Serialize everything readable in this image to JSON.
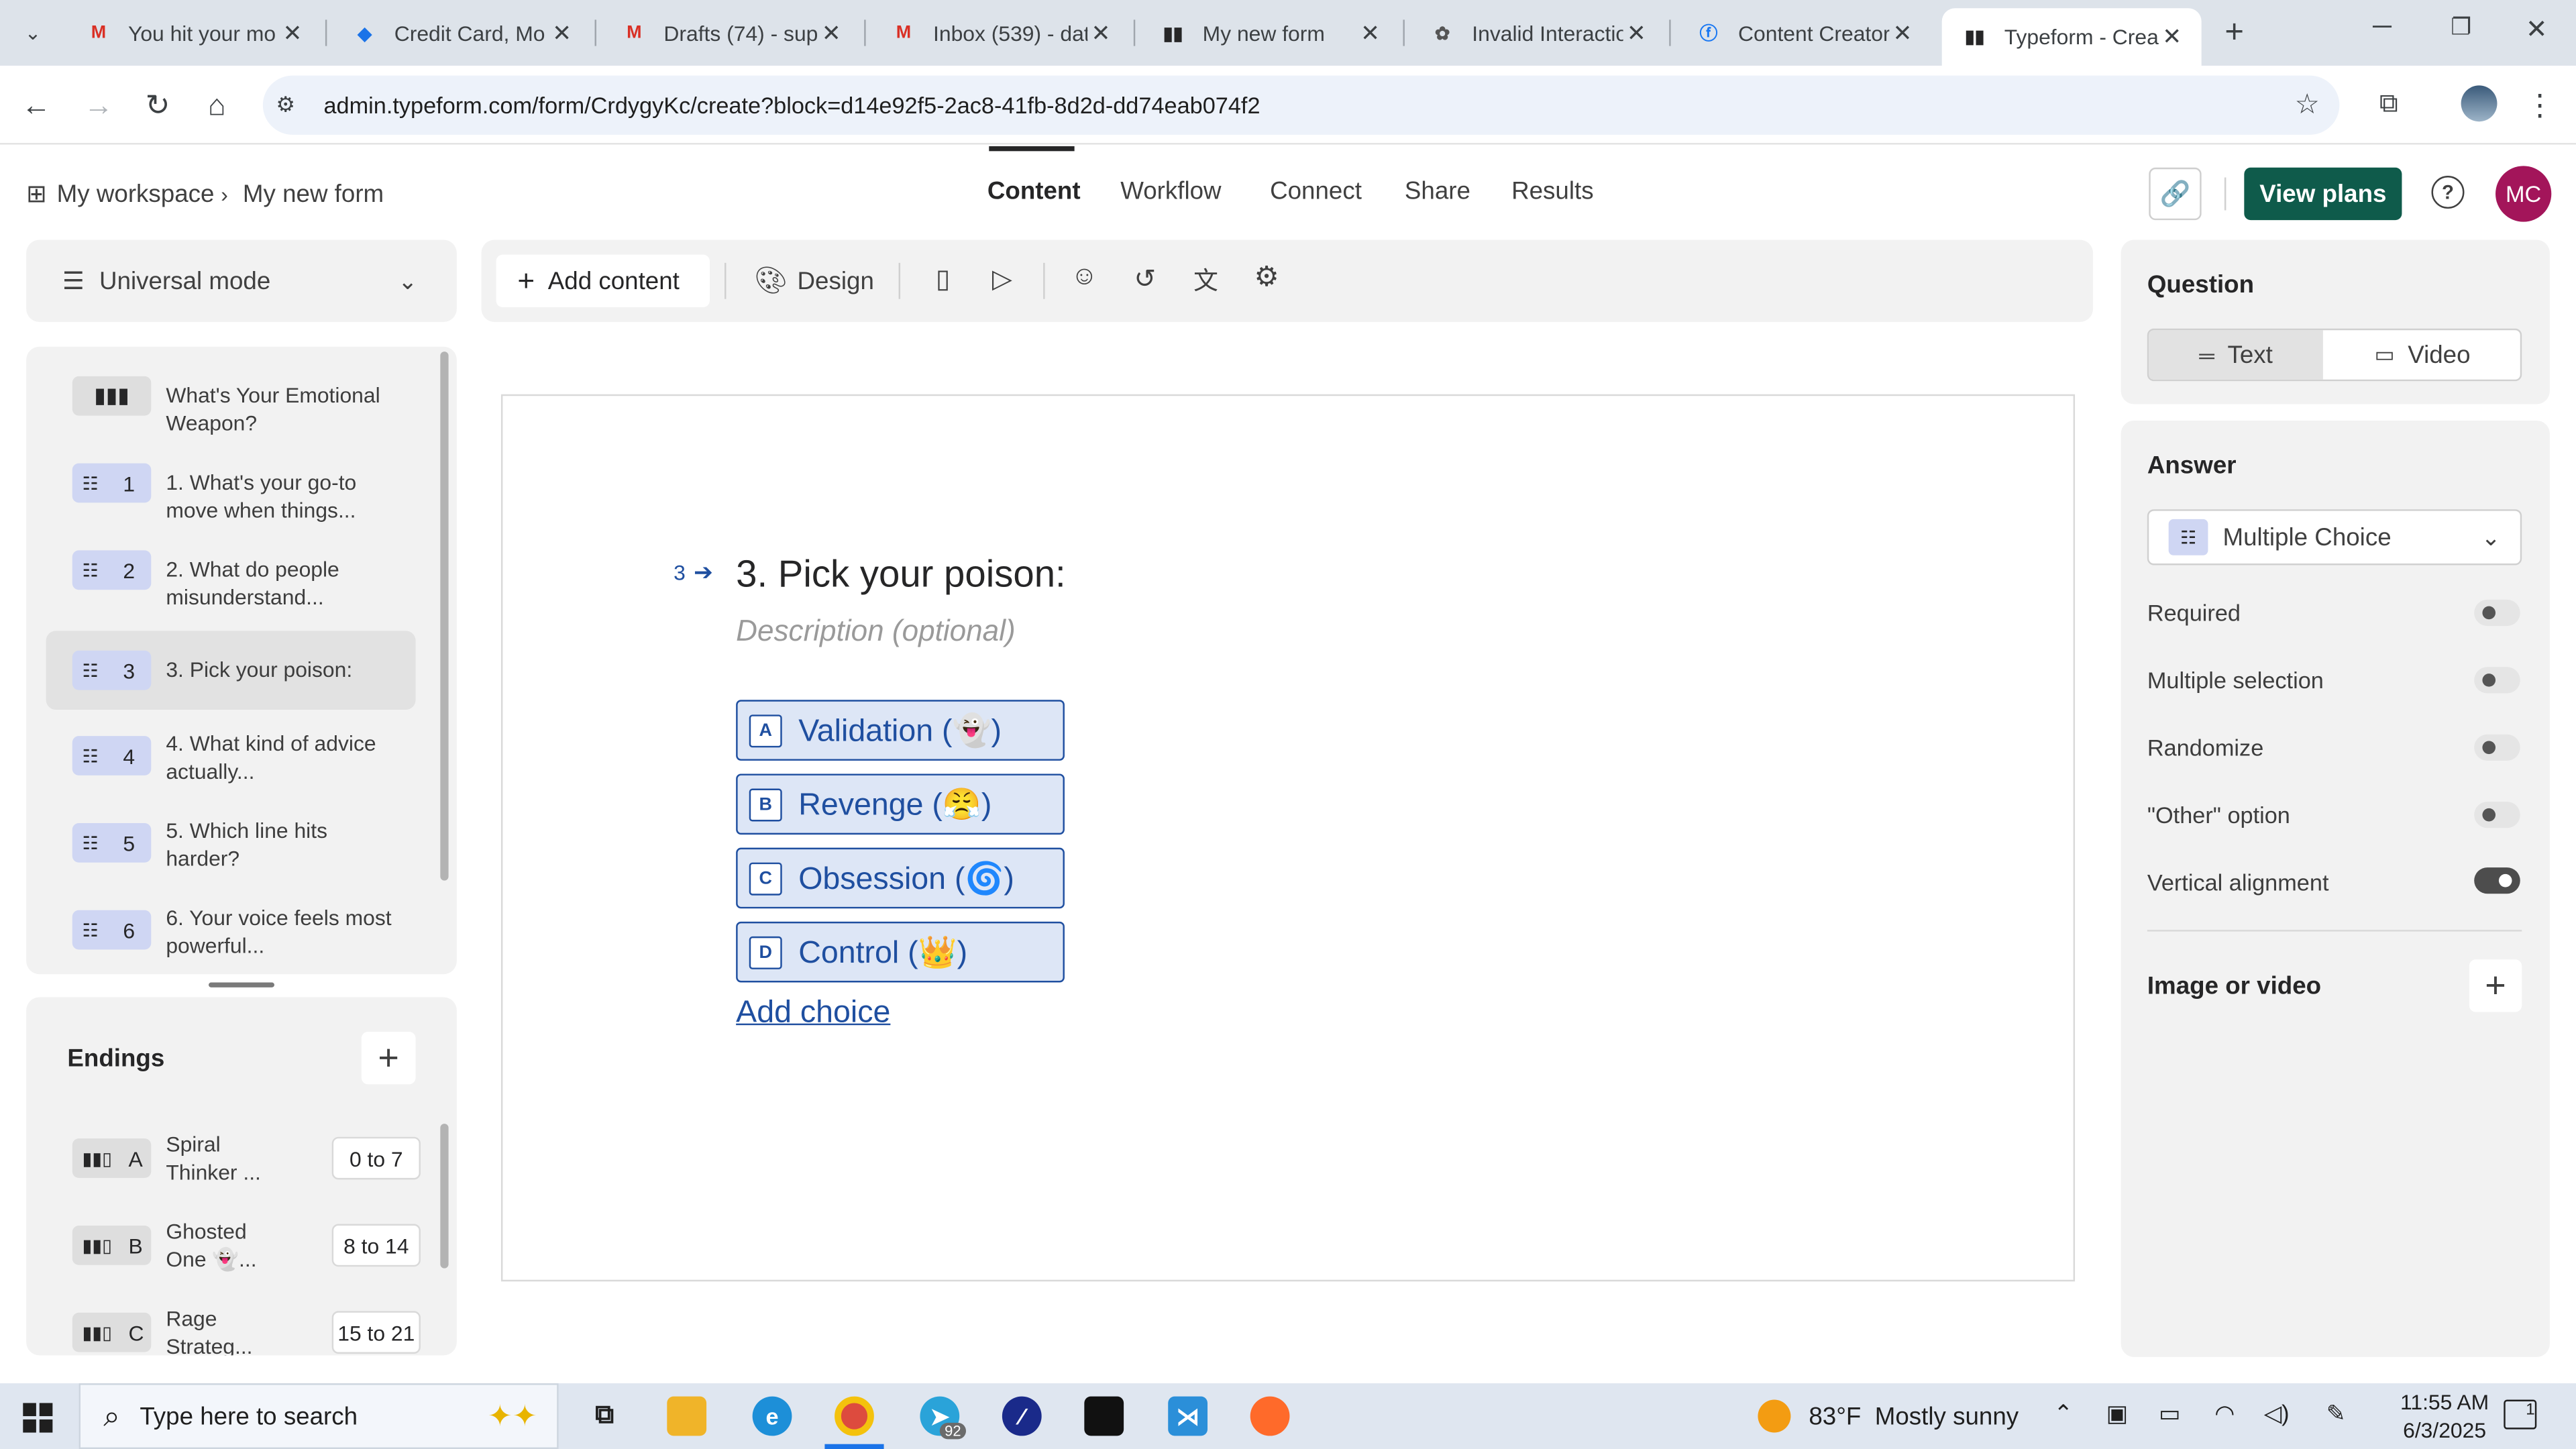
{
  "browser": {
    "tabs": [
      {
        "title": "You hit your mo",
        "favicon": "gmail-icon",
        "color": "#d93025"
      },
      {
        "title": "Credit Card, Mo",
        "favicon": "globe-icon",
        "color": "#1a73e8"
      },
      {
        "title": "Drafts (74) - sup",
        "favicon": "gmail-icon",
        "color": "#d93025"
      },
      {
        "title": "Inbox (539) - dat",
        "favicon": "gmail-icon",
        "color": "#d93025"
      },
      {
        "title": "My new form",
        "favicon": "typeform-icon",
        "color": "#262627"
      },
      {
        "title": "Invalid Interactio",
        "favicon": "openai-icon",
        "color": "#555555"
      },
      {
        "title": "Content Creator",
        "favicon": "facebook-icon",
        "color": "#1877f2"
      },
      {
        "title": "Typeform - Creat",
        "favicon": "typeform-icon",
        "color": "#262627"
      }
    ],
    "url": "admin.typeform.com/form/CrdygyKc/create?block=d14e92f5-2ac8-41fb-8d2d-dd74eab074f2"
  },
  "header": {
    "breadcrumb_workspace": "My workspace",
    "breadcrumb_form": "My new form",
    "nav": [
      "Content",
      "Workflow",
      "Connect",
      "Share",
      "Results"
    ],
    "view_plans": "View plans",
    "avatar_initials": "MC"
  },
  "left": {
    "mode_label": "Universal mode",
    "questions": [
      {
        "num": "",
        "text": "What's Your Emotional Weapon?"
      },
      {
        "num": "1",
        "text": "1. What's your go-to move when things..."
      },
      {
        "num": "2",
        "text": "2. What do people misunderstand..."
      },
      {
        "num": "3",
        "text": "3. Pick your poison:"
      },
      {
        "num": "4",
        "text": "4. What kind of advice actually..."
      },
      {
        "num": "5",
        "text": "5. Which line hits harder?"
      },
      {
        "num": "6",
        "text": "6. Your voice feels most powerful..."
      }
    ],
    "endings_title": "Endings",
    "endings": [
      {
        "letter": "A",
        "text": "Spiral Thinker ...",
        "range": "0 to 7"
      },
      {
        "letter": "B",
        "text": "Ghosted One 👻...",
        "range": "8 to 14"
      },
      {
        "letter": "C",
        "text": "Rage Strateg...",
        "range": "15 to 21"
      }
    ]
  },
  "toolbar": {
    "add_content": "Add content",
    "design": "Design"
  },
  "canvas": {
    "question_number": "3",
    "question_title": "3. Pick your poison:",
    "description_placeholder": "Description (optional)",
    "choices": [
      {
        "key": "A",
        "label": "Validation (👻)"
      },
      {
        "key": "B",
        "label": "Revenge (😤)"
      },
      {
        "key": "C",
        "label": "Obsession (🌀)"
      },
      {
        "key": "D",
        "label": "Control (👑)"
      }
    ],
    "add_choice": "Add choice"
  },
  "right": {
    "question_title": "Question",
    "text_tab": "Text",
    "video_tab": "Video",
    "answer_title": "Answer",
    "answer_type": "Multiple Choice",
    "settings": [
      {
        "label": "Required",
        "on": false
      },
      {
        "label": "Multiple selection",
        "on": false
      },
      {
        "label": "Randomize",
        "on": false
      },
      {
        "label": "\"Other\" option",
        "on": false
      },
      {
        "label": "Vertical alignment",
        "on": true
      }
    ],
    "image_video": "Image or video"
  },
  "taskbar": {
    "search_placeholder": "Type here to search",
    "weather": "83°F  Mostly sunny",
    "time": "11:55 AM",
    "date": "6/3/2025",
    "telegram_badge": "92",
    "notification_count": "1"
  }
}
